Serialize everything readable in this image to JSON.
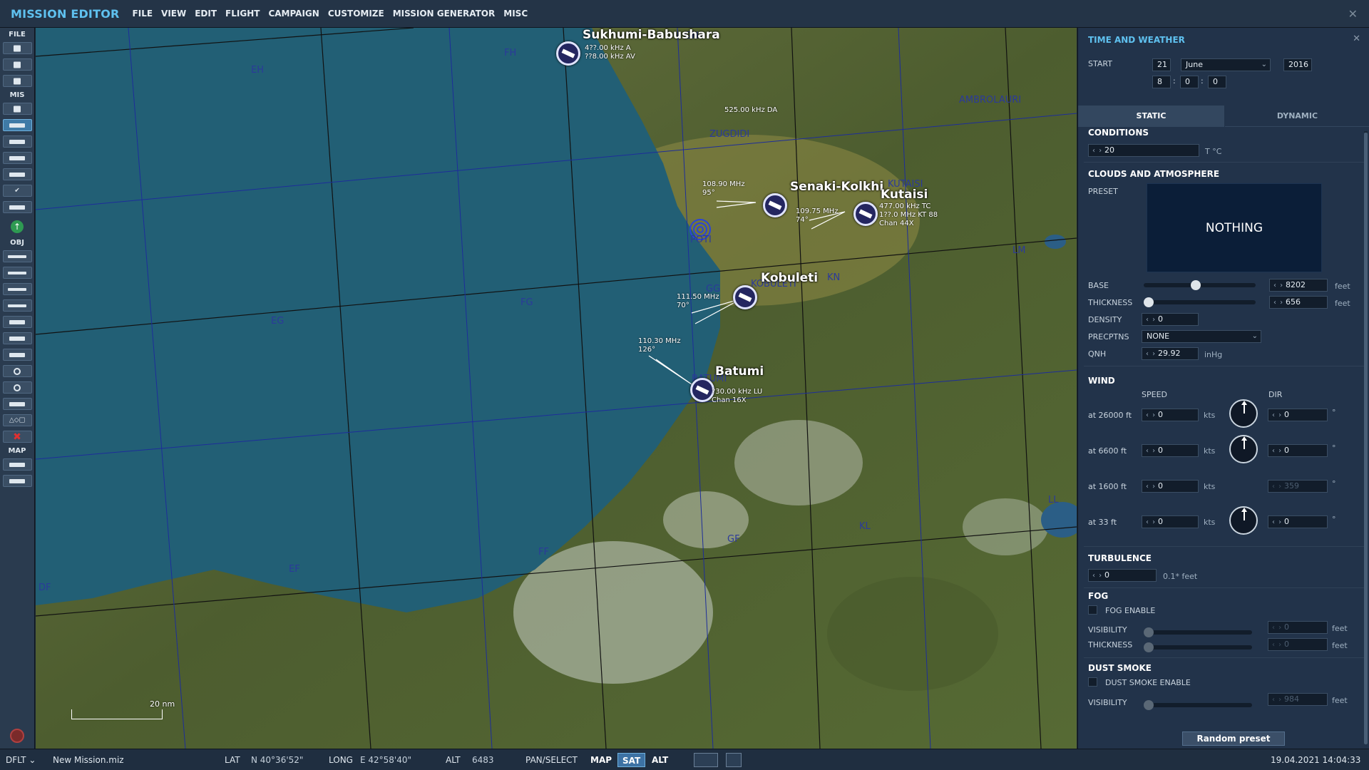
{
  "app": {
    "title": "MISSION EDITOR"
  },
  "menu": [
    "FILE",
    "VIEW",
    "EDIT",
    "FLIGHT",
    "CAMPAIGN",
    "CUSTOMIZE",
    "MISSION GENERATOR",
    "MISC"
  ],
  "toolbar": {
    "sections": {
      "file": "FILE",
      "mis": "MIS",
      "obj": "OBJ",
      "map": "MAP"
    }
  },
  "map": {
    "airfields": [
      {
        "name": "Sukhumi-Babushara",
        "freq": "4??.00 kHz A\n??8.00 kHz AV"
      },
      {
        "name": "Senaki-Kolkhi",
        "freq": "108.90 MHz\n95°"
      },
      {
        "name": "Kutaisi",
        "freq": "109.75 MHz\n74°"
      },
      {
        "name": "Kobuleti",
        "freq": "111.50 MHz\n70°"
      },
      {
        "name": "Batumi",
        "freq": "110.30 MHz\n126°"
      }
    ],
    "ndb_label": "525.00 kHz DA",
    "kutaisi_info": "477.00 kHz TC\n1??.0 MHz KT 88\nChan 44X",
    "batumi_info": "?30.00 kHz LU\nChan 16X",
    "grid_labels": [
      "EH",
      "FH",
      "GH",
      "EG",
      "FG",
      "GG",
      "KN",
      "LM",
      "EF",
      "DF",
      "FF",
      "GF",
      "KL",
      "LL",
      "AMBROLAURI",
      "ZUGDIDI",
      "KUTAISI",
      "POTI",
      "KOBULETI",
      "BATUMI"
    ],
    "scale_label": "20 nm"
  },
  "panel": {
    "title": "TIME AND WEATHER",
    "start_label": "START",
    "day": "21",
    "month": "June",
    "year": "2016",
    "hour": "8",
    "minute": "0",
    "second": "0",
    "tabs": {
      "static": "STATIC",
      "dynamic": "DYNAMIC"
    },
    "conditions": {
      "heading": "CONDITIONS",
      "temp": "20",
      "temp_unit": "T °C"
    },
    "clouds": {
      "heading": "CLOUDS AND ATMOSPHERE",
      "preset_label": "PRESET",
      "preset_value": "NOTHING",
      "base_label": "BASE",
      "base_value": "8202",
      "thickness_label": "THICKNESS",
      "thickness_value": "656",
      "density_label": "DENSITY",
      "density_value": "0",
      "precip_label": "PRECPTNS",
      "precip_value": "NONE",
      "qnh_label": "QNH",
      "qnh_value": "29.92",
      "qnh_unit": "inHg",
      "feet": "feet"
    },
    "wind": {
      "heading": "WIND",
      "speed_label": "SPEED",
      "dir_label": "DIR",
      "kts": "kts",
      "deg": "°",
      "rows": [
        {
          "alt": "at 26000 ft",
          "speed": "0",
          "dir": "0"
        },
        {
          "alt": "at 6600 ft",
          "speed": "0",
          "dir": "0"
        },
        {
          "alt": "at 1600 ft",
          "speed": "0",
          "dir": "359"
        },
        {
          "alt": "at 33 ft",
          "speed": "0",
          "dir": "0"
        }
      ]
    },
    "turbulence": {
      "heading": "TURBULENCE",
      "value": "0",
      "unit": "0.1* feet"
    },
    "fog": {
      "heading": "FOG",
      "enable_label": "FOG ENABLE",
      "visibility_label": "VISIBILITY",
      "visibility_value": "0",
      "thickness_label": "THICKNESS",
      "thickness_value": "0",
      "unit": "feet"
    },
    "dust": {
      "heading": "DUST SMOKE",
      "enable_label": "DUST SMOKE ENABLE",
      "visibility_label": "VISIBILITY",
      "visibility_value": "984",
      "unit": "feet"
    },
    "random_preset": "Random preset"
  },
  "status": {
    "profile": "DFLT",
    "file": "New Mission.miz",
    "lat_label": "LAT",
    "lat_value": "N 40°36'52\"",
    "long_label": "LONG",
    "long_value": "E 42°58'40\"",
    "alt_label": "ALT",
    "alt_value": "6483",
    "mode": "PAN/SELECT",
    "map_btn": "MAP",
    "sat_btn": "SAT",
    "alt_btn": "ALT",
    "datetime": "19.04.2021 14:04:33"
  },
  "colors": {
    "accent": "#5fc1ef",
    "sea": "#225f75",
    "panel": "#22334a"
  }
}
